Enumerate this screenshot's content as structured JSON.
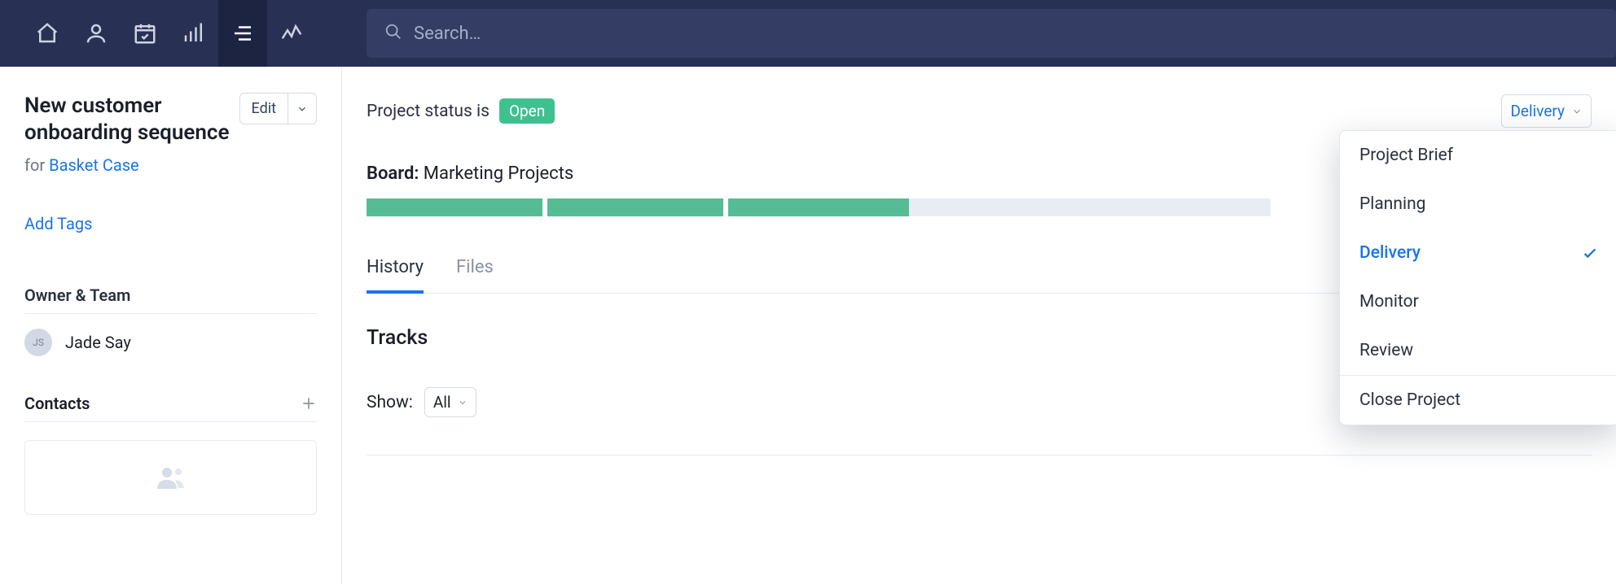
{
  "search": {
    "placeholder": "Search…"
  },
  "left": {
    "title": "New customer onboarding sequence",
    "for_prefix": "for ",
    "for_link": "Basket Case",
    "edit_label": "Edit",
    "add_tags": "Add Tags",
    "owner_team_heading": "Owner & Team",
    "owner": {
      "initials": "JS",
      "name": "Jade Say"
    },
    "contacts_heading": "Contacts"
  },
  "main": {
    "status_label": "Project status is",
    "status_value": "Open",
    "board_label": "Board:",
    "board_name": "Marketing Projects",
    "progress_segments": [
      20,
      20,
      20,
      0,
      0
    ],
    "tabs": {
      "history": "History",
      "files": "Files",
      "active": "history"
    },
    "tracks_title": "Tracks",
    "show_label": "Show:",
    "show_value": "All",
    "stage_selected": "Delivery",
    "stage_menu": [
      {
        "label": "Project Brief",
        "selected": false
      },
      {
        "label": "Planning",
        "selected": false
      },
      {
        "label": "Delivery",
        "selected": true
      },
      {
        "label": "Monitor",
        "selected": false
      },
      {
        "label": "Review",
        "selected": false
      }
    ],
    "stage_menu_footer": "Close Project"
  }
}
